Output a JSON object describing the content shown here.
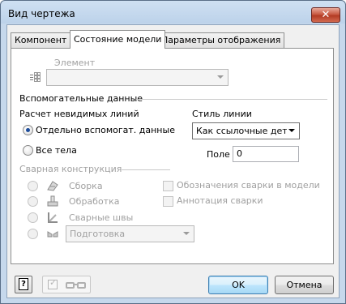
{
  "window": {
    "title": "Вид чертежа",
    "close_glyph": "✕"
  },
  "tabs": [
    {
      "label": "Компонент",
      "active": false
    },
    {
      "label": "Состояние модели",
      "active": true
    },
    {
      "label": "Параметры отображения",
      "active": false
    }
  ],
  "element": {
    "label": "Элемент",
    "value": ""
  },
  "auxiliary": {
    "group_label": "Вспомогательные данные",
    "hidden_lines_label": "Расчет невидимых линий",
    "options": [
      {
        "label": "Отдельно вспомогат. данные",
        "checked": true
      },
      {
        "label": "Все тела",
        "checked": false
      }
    ],
    "line_style_label": "Стиль линии",
    "line_style_value": "Как ссылочные детал",
    "field_label": "Поле",
    "field_value": "0"
  },
  "weldment": {
    "group_label": "Сварная конструкция",
    "items": [
      {
        "label": "Сборка",
        "icon": "assembly-icon"
      },
      {
        "label": "Обработка",
        "icon": "machining-icon"
      },
      {
        "label": "Сварные швы",
        "icon": "welds-icon"
      }
    ],
    "preparation_value": "Подготовка",
    "checkboxes": [
      {
        "label": "Обозначения сварки в модели",
        "checked": false
      },
      {
        "label": "Аннотация сварки",
        "checked": false
      }
    ]
  },
  "footer": {
    "ok_label": "OK",
    "cancel_label": "Отмена",
    "help_glyph": "?"
  },
  "colors": {
    "accent": "#1d4c9b",
    "close": "#c85a43"
  }
}
